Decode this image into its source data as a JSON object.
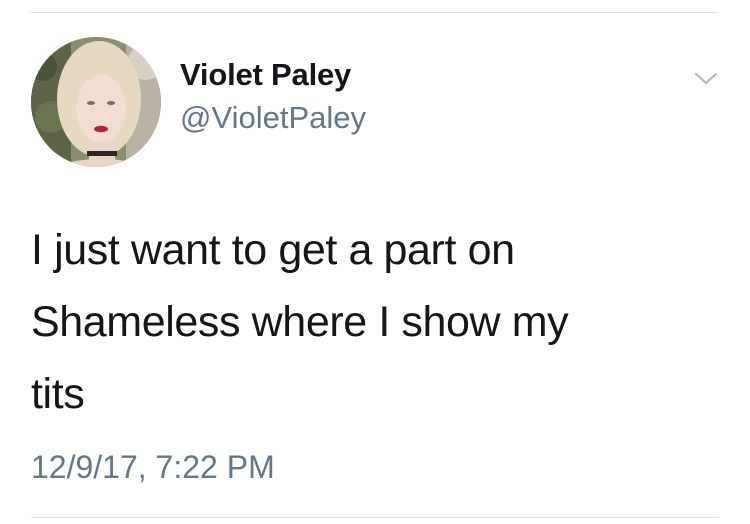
{
  "tweet": {
    "author": {
      "display_name": "Violet Paley",
      "handle": "@VioletPaley"
    },
    "text_lines": [
      "I just want to get a part on",
      "Shameless where I show my",
      "tits"
    ],
    "timestamp": "12/9/17, 7:22 PM",
    "menu_icon": "chevron-down-icon"
  },
  "colors": {
    "text_primary": "#14171a",
    "text_secondary": "#657786",
    "divider": "#d9dfe4"
  }
}
